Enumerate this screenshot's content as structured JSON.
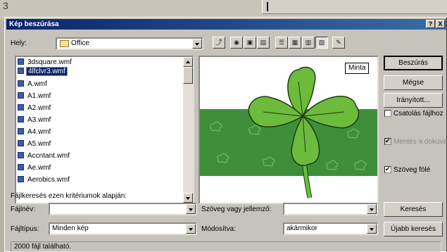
{
  "background": {
    "page_number": "3"
  },
  "dialog": {
    "title": "Kép beszúrása",
    "help_button": "?",
    "close_button": "X"
  },
  "location": {
    "label": "Hely:",
    "value": "Office"
  },
  "toolbar": {
    "icons": [
      "up-folder-icon",
      "search-web-icon",
      "new-folder-icon",
      "commands-icon",
      "list-view-icon",
      "details-view-icon",
      "properties-view-icon",
      "preview-view-icon",
      "favorites-icon"
    ]
  },
  "files": [
    "3dsquare.wmf",
    "4lfclvr3.wmf",
    "A.wmf",
    "A1.wmf",
    "A2.wmf",
    "A3.wmf",
    "A4.wmf",
    "A5.wmf",
    "Accntant.wmf",
    "Ae.wmf",
    "Aerobics.wmf"
  ],
  "selected_file": "4lfclvr3.wmf",
  "preview": {
    "label": "Minta"
  },
  "buttons": {
    "insert": "Beszúrás",
    "cancel": "Mégse",
    "advanced": "Irányított...",
    "search": "Keresés",
    "new_search": "Újabb keresés"
  },
  "checkboxes": {
    "link": {
      "label": "Csatolás fájlhoz",
      "checked": false
    },
    "save": {
      "label": "Mentés a dokuval",
      "checked": true,
      "disabled": true
    },
    "text_above": {
      "label": "Szöveg fölé",
      "checked": true
    }
  },
  "search": {
    "heading": "Fájlkeresés ezen kritériumok alapján:",
    "filename_label": "Fájlnév:",
    "filename_value": "",
    "filetype_label": "Fájltípus:",
    "filetype_value": "Minden kép",
    "text_label": "Szöveg vagy jellemző:",
    "text_value": "",
    "modified_label": "Módosítva:",
    "modified_value": "akármikor"
  },
  "status": "2000 fájl található.",
  "colors": {
    "title_start": "#0a246a",
    "title_end": "#3a6ea5",
    "selection": "#0a246a",
    "clover": "#6cbb3c",
    "preview_band": "#3f8f3a"
  }
}
